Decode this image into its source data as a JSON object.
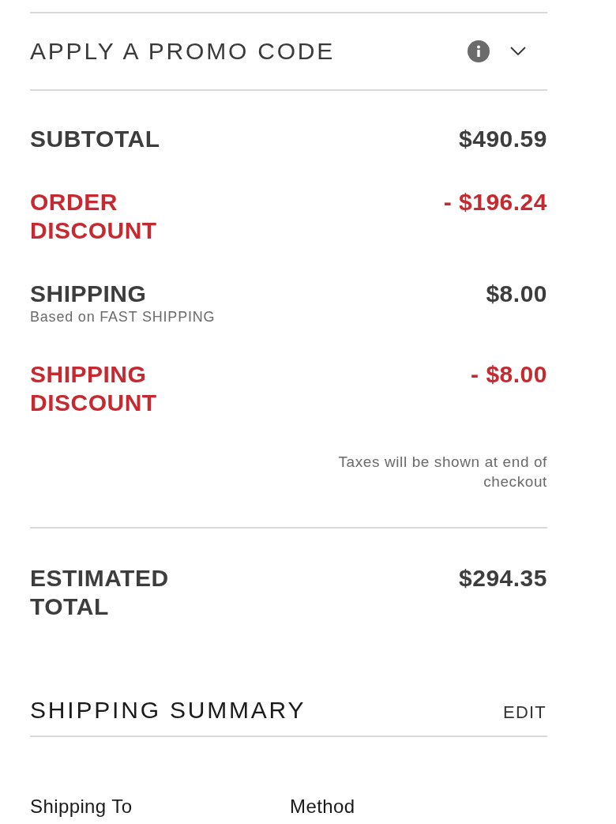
{
  "promo": {
    "title": "APPLY A PROMO CODE",
    "expanded": false
  },
  "summary_lines": [
    {
      "label": "SUBTOTAL",
      "amount": "$490.59",
      "kind": "charge"
    },
    {
      "label": "ORDER DISCOUNT",
      "amount": "- $196.24",
      "kind": "discount"
    },
    {
      "label": "SHIPPING",
      "note": "Based on FAST SHIPPING",
      "amount": "$8.00",
      "kind": "charge"
    },
    {
      "label": "SHIPPING DISCOUNT",
      "amount": "- $8.00",
      "kind": "discount"
    }
  ],
  "tax_note": "Taxes will be shown at end of checkout",
  "estimated_total": {
    "label": "ESTIMATED TOTAL",
    "amount": "$294.35"
  },
  "shipping_summary": {
    "title": "SHIPPING SUMMARY",
    "edit": "EDIT",
    "columns": [
      "Shipping To",
      "Method"
    ]
  }
}
